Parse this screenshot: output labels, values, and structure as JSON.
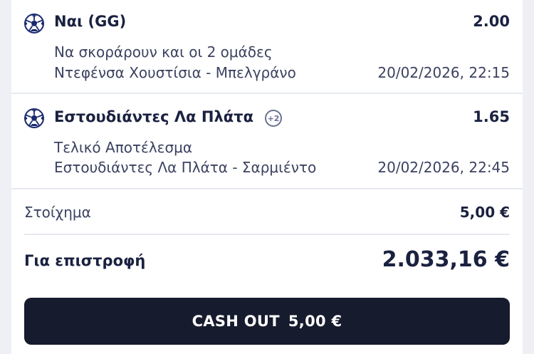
{
  "bets": [
    {
      "title": "Ναι (GG)",
      "odds": "2.00",
      "market": "Να σκοράρουν και οι 2 ομάδες",
      "event": "Ντεφένσα Χουστίσια - Μπελγράνο",
      "datetime": "20/02/2026, 22:15",
      "icon": "soccer-ball-icon"
    },
    {
      "title": "Εστουδιάντες Λα Πλάτα",
      "badge": "+2",
      "odds": "1.65",
      "market": "Τελικό Αποτέλεσμα",
      "event": "Εστουδιάντες Λα Πλάτα - Σαρμιέντο",
      "datetime": "20/02/2026, 22:45",
      "icon": "soccer-ball-icon"
    }
  ],
  "summary": {
    "stake_label": "Στοίχημα",
    "stake_value": "5,00 €",
    "return_label": "Για επιστροφή",
    "return_value": "2.033,16 €"
  },
  "cashout": {
    "label": "CASH OUT",
    "amount": "5,00 €"
  },
  "colors": {
    "text_primary": "#1a2140",
    "text_secondary": "#3b4260",
    "button_bg": "#161b2e",
    "page_bg": "#eef0f5"
  }
}
